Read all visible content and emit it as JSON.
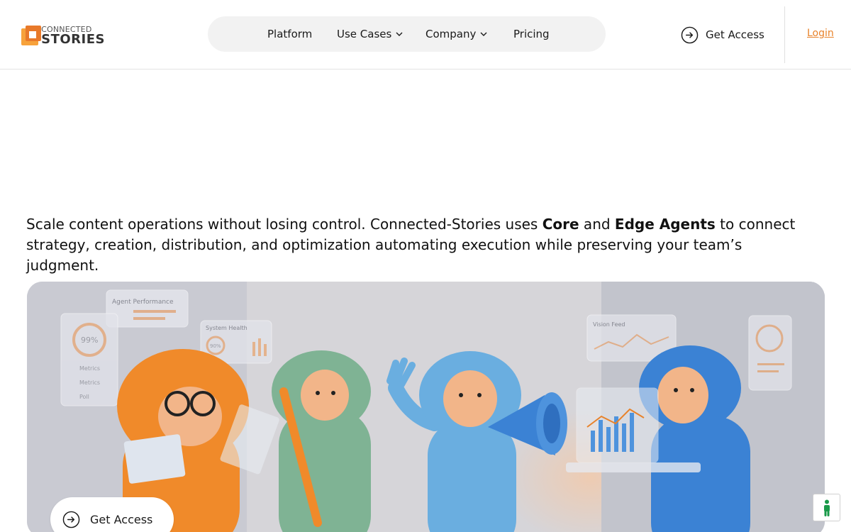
{
  "brand": {
    "line1": "CONNECTED",
    "line2": "STORIES"
  },
  "nav": {
    "platform": "Platform",
    "use_cases": "Use Cases",
    "company": "Company",
    "pricing": "Pricing"
  },
  "header": {
    "get_access": "Get Access",
    "login": "Login"
  },
  "intro": {
    "part1": "Scale content operations without losing control. Connected-Stories uses ",
    "core": "Core",
    "and": " and ",
    "edge": "Edge Agents",
    "part2": " to connect strategy, creation, distribution, and optimization automating execution while preserving your team’s judgment."
  },
  "hero": {
    "panel_agent_performance": "Agent Performance",
    "panel_system_health": "System Health",
    "panel_vision_feed": "Vision Feed",
    "gauge_value": "99%",
    "gauge_small": "90%",
    "metric1": "Metrics",
    "metric2": "Metrics",
    "metric3": "Poll"
  },
  "cta": {
    "label": "Get Access"
  },
  "colors": {
    "accent": "#e8822a",
    "orange_character": "#f08a2a",
    "green_character": "#7fb394",
    "light_blue_character": "#6aaee0",
    "blue_character": "#3b82d4"
  }
}
